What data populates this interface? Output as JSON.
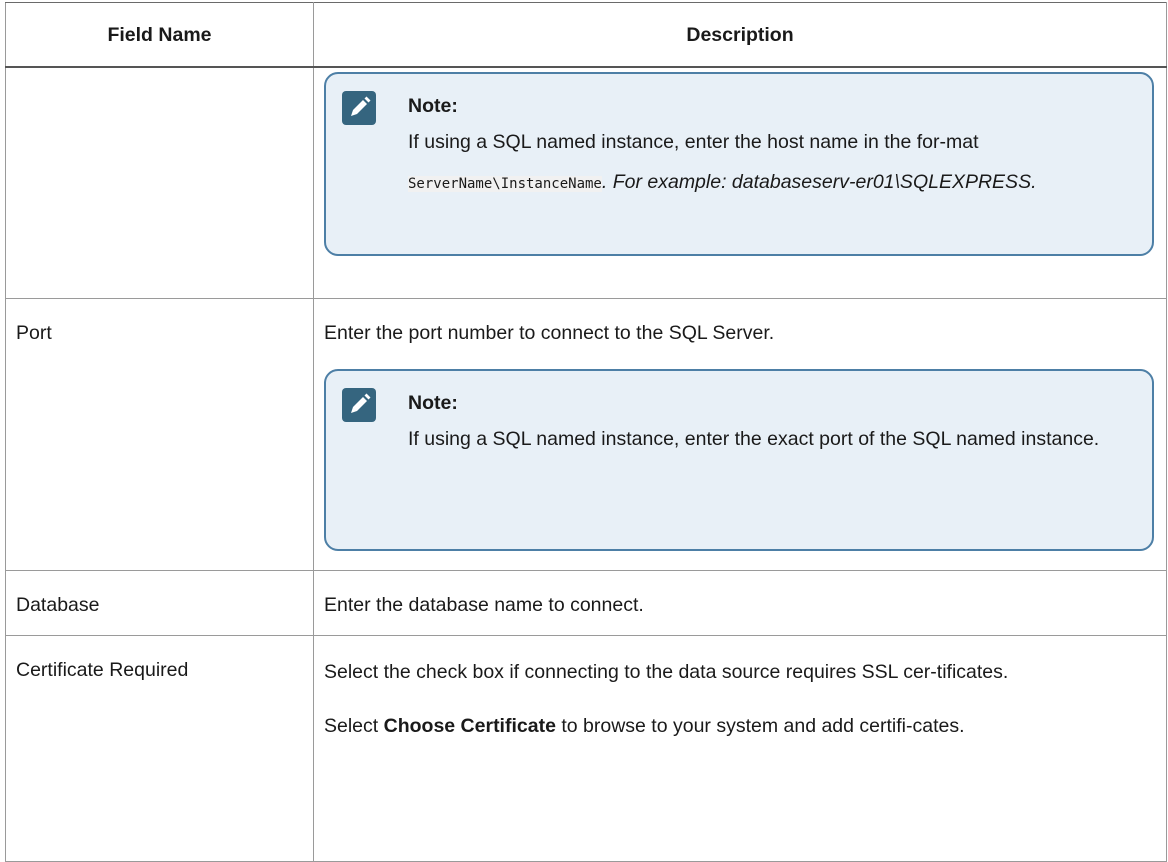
{
  "table": {
    "headers": [
      "Field Name",
      "Description"
    ],
    "rows": {
      "host_continuation": {
        "field": "",
        "note": {
          "title": "Note:",
          "text_before": "If using a SQL named instance, enter the host name in the for-mat ",
          "code": "ServerName\\InstanceName",
          "text_after": ". For example: databaseserv-er01\\SQLEXPRESS."
        }
      },
      "port": {
        "field": "Port",
        "description": "Enter the port number to connect to the SQL Server.",
        "note": {
          "title": "Note:",
          "text": "If using a SQL named instance, enter the exact port of the SQL named instance."
        }
      },
      "database": {
        "field": "Database",
        "description": "Enter the database name to connect."
      },
      "certificate": {
        "field": "Certificate Required",
        "description": "Select the check box if connecting to the data source requires SSL cer-tificates.",
        "para_before": "Select ",
        "para_bold": "Choose Certificate",
        "para_after": " to browse to your system and add certifi-cates."
      }
    }
  },
  "icons": {
    "note_icon": "pencil-icon",
    "note_icon_color": "#35657f",
    "note_background": "#e8f0f7",
    "note_border": "#4d7fa6"
  }
}
